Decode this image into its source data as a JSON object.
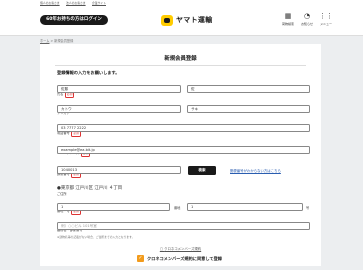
{
  "top_links": [
    "個人のお客さま",
    "法人のお客さま",
    "企業サイト"
  ],
  "header": {
    "cta_label": "60年お持ちの方はログイン",
    "logo_text": "ヤマト運輸",
    "icons": [
      {
        "name": "qr",
        "glyph": "▦",
        "label": "荷物検索"
      },
      {
        "name": "bell",
        "glyph": "◔",
        "label": "お知らせ"
      },
      {
        "name": "menu",
        "glyph": "⋮⋮",
        "label": "メニュー"
      }
    ]
  },
  "breadcrumb": {
    "home": "ホーム",
    "separator": ">",
    "current": "新規会員登録"
  },
  "form": {
    "title": "新規会員登録",
    "intro": "登録情報の入力をお願いします。",
    "required_badge": "必須",
    "name": {
      "label": "氏名",
      "last": "佐藤",
      "first": "佐"
    },
    "kana": {
      "label": "フリガナ",
      "last": "カトウ",
      "first": "サキ"
    },
    "phone": {
      "label": "電話番号",
      "value": "03 7777 2222"
    },
    "email": {
      "label": "メールアドレス",
      "value": "example@ea.bit.jp"
    },
    "postal": {
      "label": "郵便番号",
      "value": "1040013",
      "search_label": "検索",
      "help_link": "郵便番号がわからない方はこちら"
    },
    "address": {
      "label": "ご住所",
      "value": "●東京都 江戸川区 江戸川 ４丁目"
    },
    "banchi": {
      "label": "番地・号",
      "value": "1",
      "sep_label": "番地",
      "value2": "1",
      "unit_label": "号"
    },
    "building": {
      "label": "建物名・部屋番号",
      "placeholder": "例）○○ビル 101号室"
    },
    "note": "※建物名等の記載がない場合、ご住所までの入力となります。",
    "terms_link": "クロネコメンバーズ規約",
    "agree_label": "クロネコメンバーズ規約に同意して登録"
  }
}
